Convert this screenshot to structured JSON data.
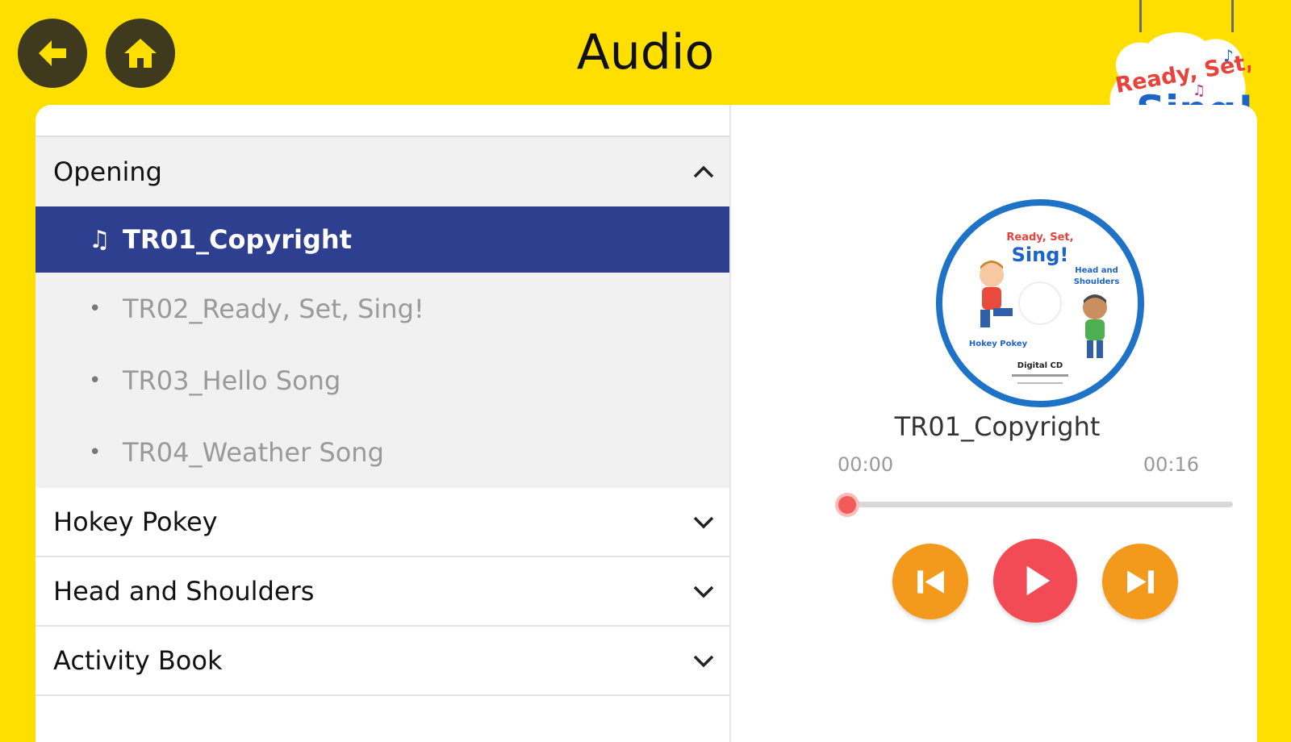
{
  "header": {
    "title": "Audio",
    "back_icon": "back-arrow-icon",
    "home_icon": "home-icon",
    "logo": {
      "line1": "Ready, Set,",
      "line2": "Sing!"
    }
  },
  "colors": {
    "background": "#FFDF00",
    "active_track": "#2E3F8F",
    "accent_red": "#F24B55",
    "accent_orange": "#F39A1C"
  },
  "sections": [
    {
      "label": "Opening",
      "expanded": true,
      "tracks": [
        {
          "label": "TR01_Copyright",
          "active": true
        },
        {
          "label": "TR02_Ready, Set, Sing!"
        },
        {
          "label": "TR03_Hello Song"
        },
        {
          "label": "TR04_Weather Song"
        }
      ]
    },
    {
      "label": "Hokey Pokey",
      "expanded": false
    },
    {
      "label": "Head and Shoulders",
      "expanded": false
    },
    {
      "label": "Activity Book",
      "expanded": false
    }
  ],
  "player": {
    "now_playing": "TR01_Copyright",
    "current_time": "00:00",
    "total_time": "00:16",
    "progress": 0.0,
    "cd_art": {
      "logo_line1": "Ready, Set,",
      "logo_line2": "Sing!",
      "label_left": "Hokey Pokey",
      "label_right_1": "Head and",
      "label_right_2": "Shoulders",
      "label_bottom": "Digital CD"
    },
    "controls": [
      "previous-icon",
      "play-icon",
      "next-icon"
    ]
  }
}
